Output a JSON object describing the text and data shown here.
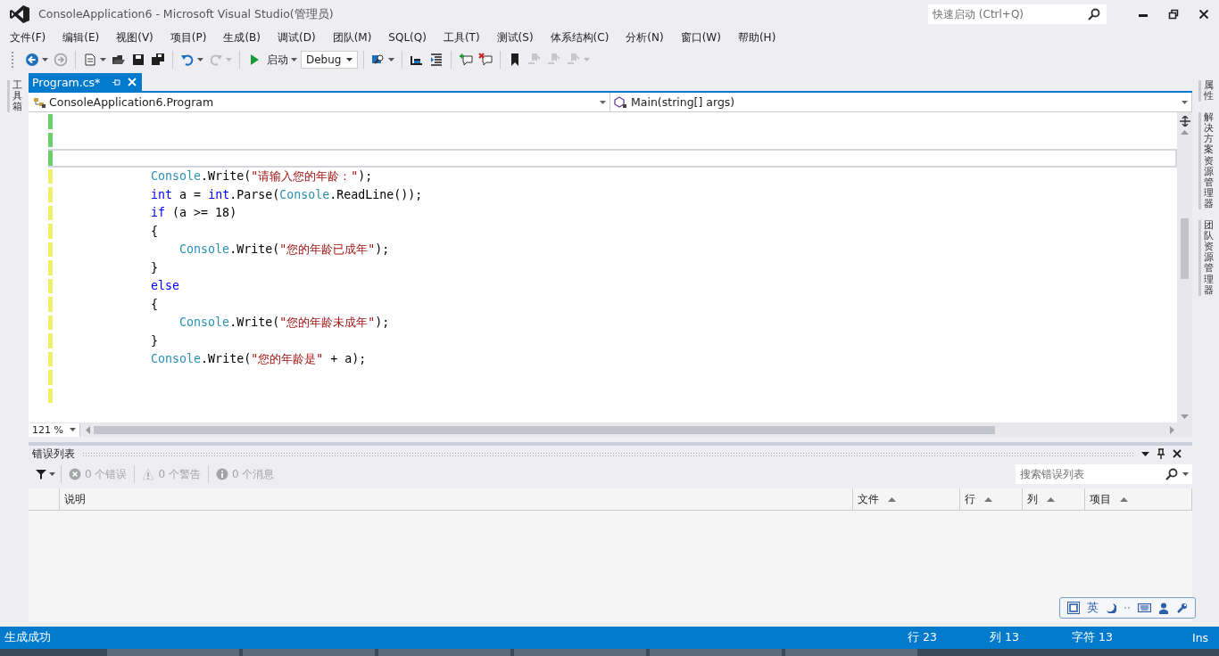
{
  "window": {
    "title": "ConsoleApplication6 - Microsoft Visual Studio(管理员)",
    "quick_launch": {
      "placeholder": "快速启动 (Ctrl+Q)"
    }
  },
  "menu": [
    "文件(F)",
    "编辑(E)",
    "视图(V)",
    "项目(P)",
    "生成(B)",
    "调试(D)",
    "团队(M)",
    "SQL(Q)",
    "工具(T)",
    "测试(S)",
    "体系结构(C)",
    "分析(N)",
    "窗口(W)",
    "帮助(H)"
  ],
  "toolbar": [
    {
      "kind": "back",
      "disabled": false,
      "dropdown": true
    },
    {
      "kind": "forward",
      "disabled": true,
      "dropdown": false
    },
    {
      "kind": "separator"
    },
    {
      "kind": "new-project",
      "disabled": false,
      "dropdown": true
    },
    {
      "kind": "open",
      "disabled": false,
      "dropdown": false
    },
    {
      "kind": "save",
      "disabled": false,
      "dropdown": false
    },
    {
      "kind": "save-all",
      "disabled": false,
      "dropdown": false
    },
    {
      "kind": "separator"
    },
    {
      "kind": "undo",
      "disabled": false,
      "dropdown": true
    },
    {
      "kind": "redo",
      "disabled": true,
      "dropdown": true
    },
    {
      "kind": "separator"
    },
    {
      "kind": "start",
      "label": "启动",
      "disabled": false,
      "dropdown": true
    },
    {
      "kind": "combo",
      "value": "Debug"
    },
    {
      "kind": "separator"
    },
    {
      "kind": "find",
      "disabled": false,
      "dropdown": true
    },
    {
      "kind": "separator"
    },
    {
      "kind": "indent-less",
      "disabled": false,
      "dropdown": false
    },
    {
      "kind": "indent-more",
      "disabled": false,
      "dropdown": false
    },
    {
      "kind": "separator"
    },
    {
      "kind": "comment",
      "disabled": false,
      "dropdown": false
    },
    {
      "kind": "uncomment",
      "disabled": false,
      "dropdown": false
    },
    {
      "kind": "separator"
    },
    {
      "kind": "bookmark",
      "disabled": false,
      "dropdown": false
    },
    {
      "kind": "bookmark-prev",
      "disabled": true,
      "dropdown": false
    },
    {
      "kind": "bookmark-next",
      "disabled": true,
      "dropdown": false
    },
    {
      "kind": "bookmark-clear",
      "disabled": true,
      "dropdown": true
    }
  ],
  "left_panel_tabs": [
    "工具箱"
  ],
  "right_panel_tabs": [
    "属性",
    "解决方案资源管理器",
    "团队资源管理器"
  ],
  "document_tabs": [
    {
      "label": "Program.cs*",
      "selected": true
    }
  ],
  "navigation": {
    "type": "ConsoleApplication6.Program",
    "member": "Main(string[] args)"
  },
  "editor": {
    "lines": [
      {
        "saved": true,
        "current": false
      },
      {
        "saved": true,
        "current": false
      },
      {
        "saved": true,
        "current": true
      },
      {
        "saved": false,
        "current": false,
        "kind": "method-body",
        "tokens": [
          {
            "kind": "type",
            "text": "Console"
          },
          {
            "kind": "plain",
            "text": ".Write("
          },
          {
            "kind": "string",
            "text": "\"请输入您的年龄：\""
          },
          {
            "kind": "plain",
            "text": ");"
          }
        ]
      },
      {
        "saved": false,
        "current": false,
        "kind": "method-body",
        "tokens": [
          {
            "kind": "keyword",
            "text": "int"
          },
          {
            "kind": "plain",
            "text": " a = "
          },
          {
            "kind": "keyword",
            "text": "int"
          },
          {
            "kind": "plain",
            "text": ".Parse("
          },
          {
            "kind": "type",
            "text": "Console"
          },
          {
            "kind": "plain",
            "text": ".ReadLine());"
          }
        ]
      },
      {
        "saved": false,
        "current": false,
        "kind": "method-body",
        "tokens": [
          {
            "kind": "keyword",
            "text": "if"
          },
          {
            "kind": "plain",
            "text": " (a >= 18)"
          }
        ]
      },
      {
        "saved": false,
        "current": false,
        "kind": "method-body",
        "tokens": [
          {
            "kind": "plain",
            "text": "{"
          }
        ]
      },
      {
        "saved": false,
        "current": false,
        "kind": "block-body",
        "tokens": [
          {
            "kind": "type",
            "text": "Console"
          },
          {
            "kind": "plain",
            "text": ".Write("
          },
          {
            "kind": "string",
            "text": "\"您的年龄已成年\""
          },
          {
            "kind": "plain",
            "text": ");"
          }
        ]
      },
      {
        "saved": false,
        "current": false,
        "kind": "method-body",
        "tokens": [
          {
            "kind": "plain",
            "text": "}"
          }
        ]
      },
      {
        "saved": false,
        "current": false,
        "kind": "method-body",
        "tokens": [
          {
            "kind": "keyword",
            "text": "else"
          }
        ]
      },
      {
        "saved": false,
        "current": false,
        "kind": "method-body",
        "tokens": [
          {
            "kind": "plain",
            "text": "{"
          }
        ]
      },
      {
        "saved": false,
        "current": false,
        "kind": "block-body",
        "tokens": [
          {
            "kind": "type",
            "text": "Console"
          },
          {
            "kind": "plain",
            "text": ".Write("
          },
          {
            "kind": "string",
            "text": "\"您的年龄未成年\""
          },
          {
            "kind": "plain",
            "text": ");"
          }
        ]
      },
      {
        "saved": false,
        "current": false,
        "kind": "method-body",
        "tokens": [
          {
            "kind": "plain",
            "text": "}"
          }
        ]
      },
      {
        "saved": false,
        "current": false,
        "kind": "method-body",
        "tokens": [
          {
            "kind": "type",
            "text": "Console"
          },
          {
            "kind": "plain",
            "text": ".Write("
          },
          {
            "kind": "string",
            "text": "\"您的年龄是\""
          },
          {
            "kind": "plain",
            "text": " + a);"
          }
        ]
      },
      {
        "saved": false,
        "current": false
      },
      {
        "saved": false,
        "current": false
      }
    ],
    "zoom": "121 %"
  },
  "error_list": {
    "title": "错误列表",
    "filters": [
      {
        "kind": "error",
        "label": "0 个错误",
        "disabled": true
      },
      {
        "kind": "warning",
        "label": "0 个警告",
        "disabled": true
      },
      {
        "kind": "message",
        "label": "0 个消息",
        "disabled": true
      }
    ],
    "search": {
      "placeholder": "搜索错误列表"
    },
    "columns": [
      "说明",
      "文件",
      "行",
      "列",
      "项目"
    ]
  },
  "ime_bar": {
    "language": "英"
  },
  "status_bar": {
    "message": "生成成功",
    "line": "行 23",
    "column": "列 13",
    "char": "字符 13",
    "mode": "Ins"
  }
}
